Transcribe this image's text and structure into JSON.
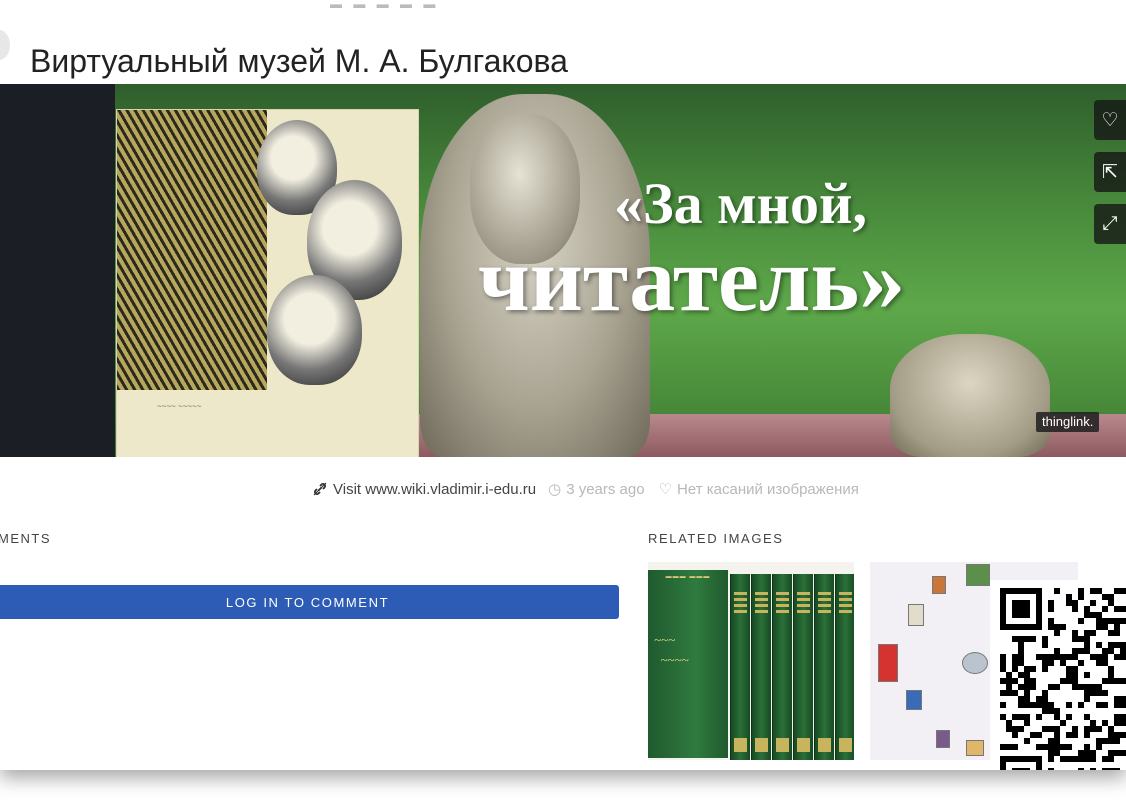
{
  "page": {
    "title": "Виртуальный музей М. А. Булгакова"
  },
  "hero": {
    "quote_line1": "«За мной,",
    "quote_line2": "читатель»",
    "watermark": "thinglink.",
    "actions": [
      {
        "icon": "heart-icon",
        "glyph": "♡"
      },
      {
        "icon": "share-icon",
        "glyph": "⇱"
      },
      {
        "icon": "fullscreen-icon",
        "glyph": "⤢"
      }
    ]
  },
  "meta": {
    "visit_label": "Visit www.wiki.vladimir.i-edu.ru",
    "time_label": "3 years ago",
    "taps_label": "Нет касаний изображения"
  },
  "comments": {
    "heading": "MENTS",
    "login_label": "LOG IN TO COMMENT"
  },
  "related": {
    "heading": "RELATED IMAGES"
  },
  "colors": {
    "login_button": "#2c5cb5",
    "hero_dark": "#1b1e24",
    "muted_text": "#b8b8b8"
  }
}
